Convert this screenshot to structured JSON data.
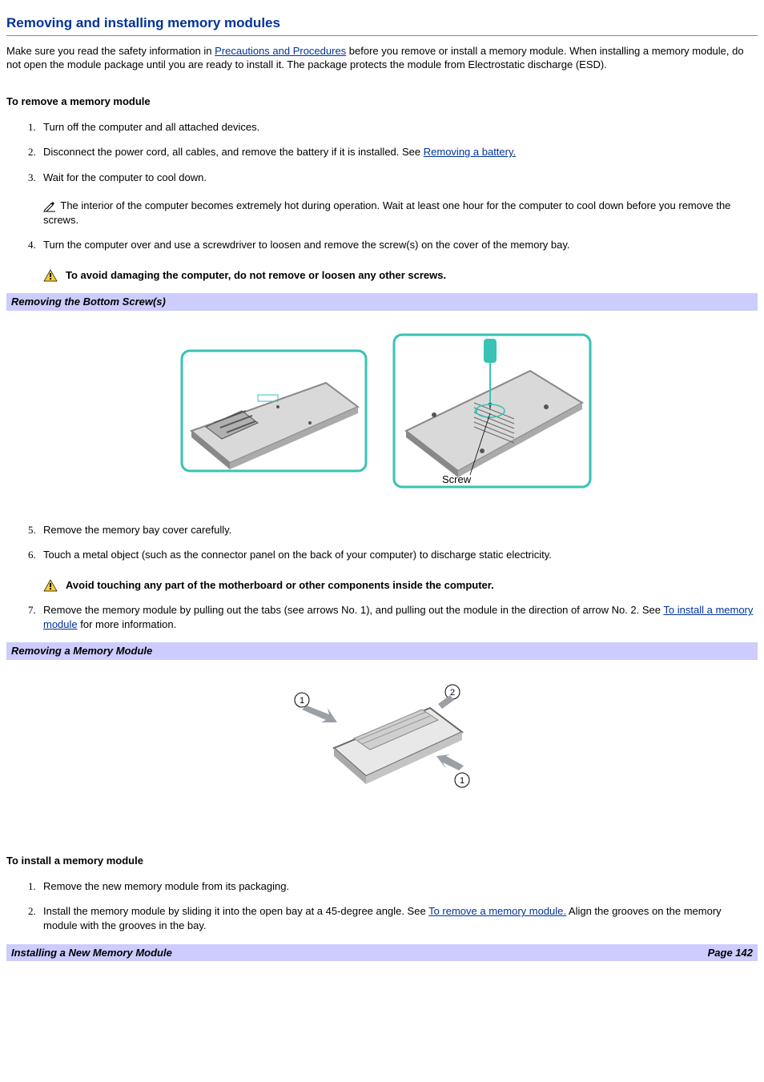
{
  "title": "Removing and installing memory modules",
  "intro": {
    "part1": "Make sure you read the safety information in ",
    "link1": "Precautions and Procedures",
    "part2": " before you remove or install a memory module. When installing a memory module, do not open the module package until you are ready to install it. The package protects the module from Electrostatic discharge (ESD)."
  },
  "remove": {
    "heading": "To remove a memory module",
    "steps": {
      "s1": "Turn off the computer and all attached devices.",
      "s2a": "Disconnect the power cord, all cables, and remove the battery if it is installed. See ",
      "s2link": "Removing a battery.",
      "s3": "Wait for the computer to cool down.",
      "s3_note": " The interior of the computer becomes extremely hot during operation. Wait at least one hour for the computer to cool down before you remove the screws.",
      "s4": "Turn the computer over and use a screwdriver to loosen and remove the screw(s) on the cover of the memory bay.",
      "s4_warning": "To avoid damaging the computer, do not remove or loosen any other screws.",
      "s5": "Remove the memory bay cover carefully.",
      "s6": "Touch a metal object (such as the connector panel on the back of your computer) to discharge static electricity.",
      "s6_warning": "Avoid touching any part of the motherboard or other components inside the computer.",
      "s7a": "Remove the memory module by pulling out the tabs (see arrows No. 1), and pulling out the module in the direction of arrow No. 2. See ",
      "s7link": "To install a memory module",
      "s7b": " for more information."
    }
  },
  "fig1": {
    "caption": "Removing the Bottom Screw(s)",
    "screw_label": "Screw"
  },
  "fig2": {
    "caption": "Removing a Memory Module"
  },
  "install": {
    "heading": "To install a memory module",
    "steps": {
      "s1": "Remove the new memory module from its packaging.",
      "s2a": "Install the memory module by sliding it into the open bay at a 45-degree angle. See ",
      "s2link": "To remove a memory module.",
      "s2b": " Align the grooves on the memory module with the grooves in the bay."
    }
  },
  "footer": {
    "left": "Installing a New Memory Module",
    "right": "Page 142"
  }
}
